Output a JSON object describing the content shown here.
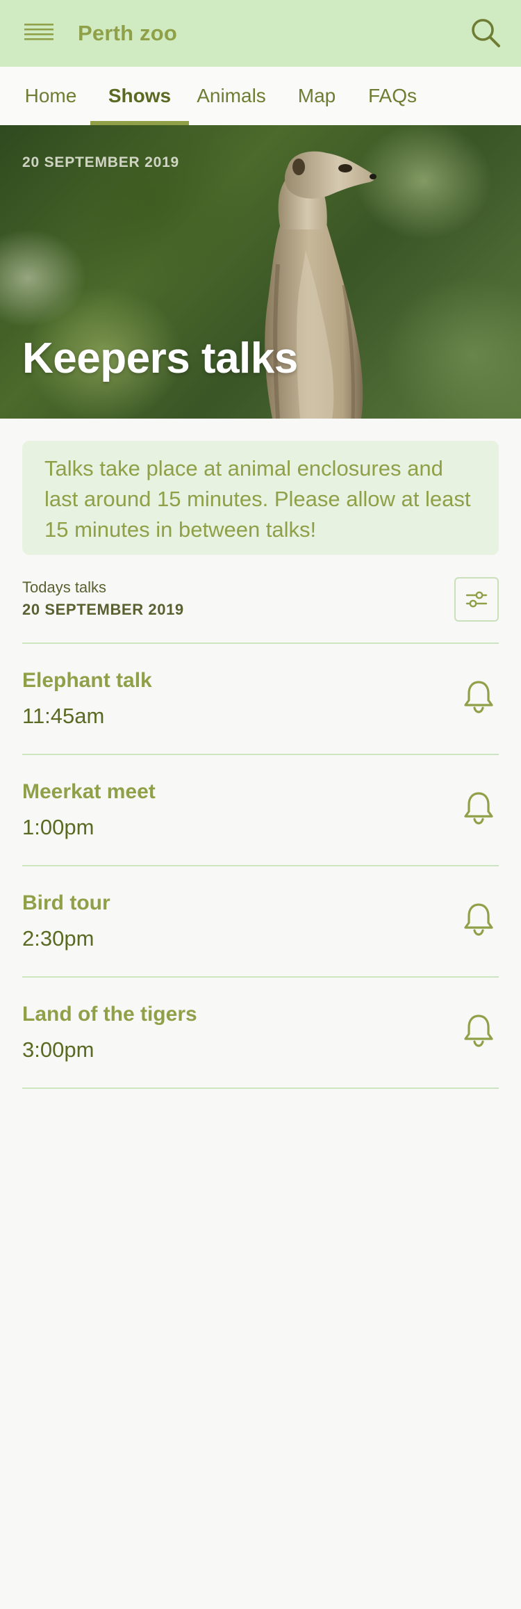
{
  "app": {
    "title": "Perth zoo"
  },
  "colors": {
    "app_bar": "#d0ebc1",
    "accent": "#8fa048",
    "accent_dark": "#5b6a22",
    "info_card": "#e7f2e0",
    "divider": "#cde4c0",
    "page_bg": "#f8f8f7"
  },
  "icons": {
    "menu": "hamburger-menu-icon",
    "search": "search-icon",
    "filter": "sliders-filter-icon",
    "bell": "bell-icon"
  },
  "tabs": [
    {
      "label": "Home",
      "active": false
    },
    {
      "label": "Shows",
      "active": true
    },
    {
      "label": "Animals",
      "active": false
    },
    {
      "label": "Map",
      "active": false
    },
    {
      "label": "FAQs",
      "active": false
    }
  ],
  "hero": {
    "date": "20 SEPTEMBER 2019",
    "title": "Keepers talks"
  },
  "info": {
    "text": "Talks take place at animal enclosures and last around 15 minutes. Please allow at least 15 minutes in between talks!"
  },
  "today": {
    "label": "Todays talks",
    "date": "20 SEPTEMBER 2019"
  },
  "talks": [
    {
      "name": "Elephant talk",
      "time": "11:45am"
    },
    {
      "name": "Meerkat meet",
      "time": "1:00pm"
    },
    {
      "name": "Bird tour",
      "time": "2:30pm"
    },
    {
      "name": "Land of the tigers",
      "time": "3:00pm"
    }
  ]
}
